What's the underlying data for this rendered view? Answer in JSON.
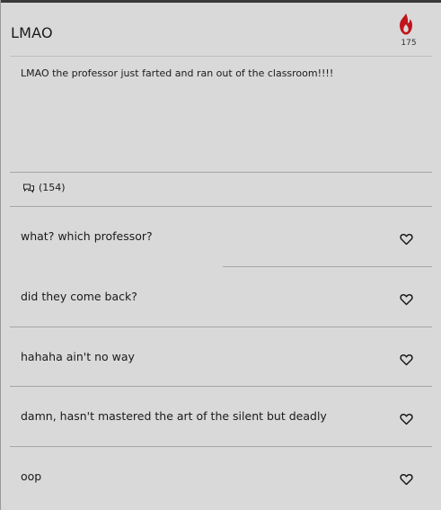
{
  "post": {
    "title": "LMAO",
    "heat_count": "175",
    "body": "LMAO the professor just farted and ran out of the classroom!!!!",
    "comments_label": "(154)"
  },
  "replies": [
    {
      "text": "what? which professor?"
    },
    {
      "text": "did they come back?"
    },
    {
      "text": "hahaha ain't no way"
    },
    {
      "text": "damn, hasn't mastered the art of the silent but deadly"
    },
    {
      "text": "oop"
    }
  ],
  "colors": {
    "background": "#d9d9d9",
    "flame": "#c0141c",
    "divider": "#a6a6a6"
  },
  "icons": {
    "heat": "flame-icon",
    "comments": "speech-bubbles-icon",
    "like": "heart-outline-icon"
  }
}
